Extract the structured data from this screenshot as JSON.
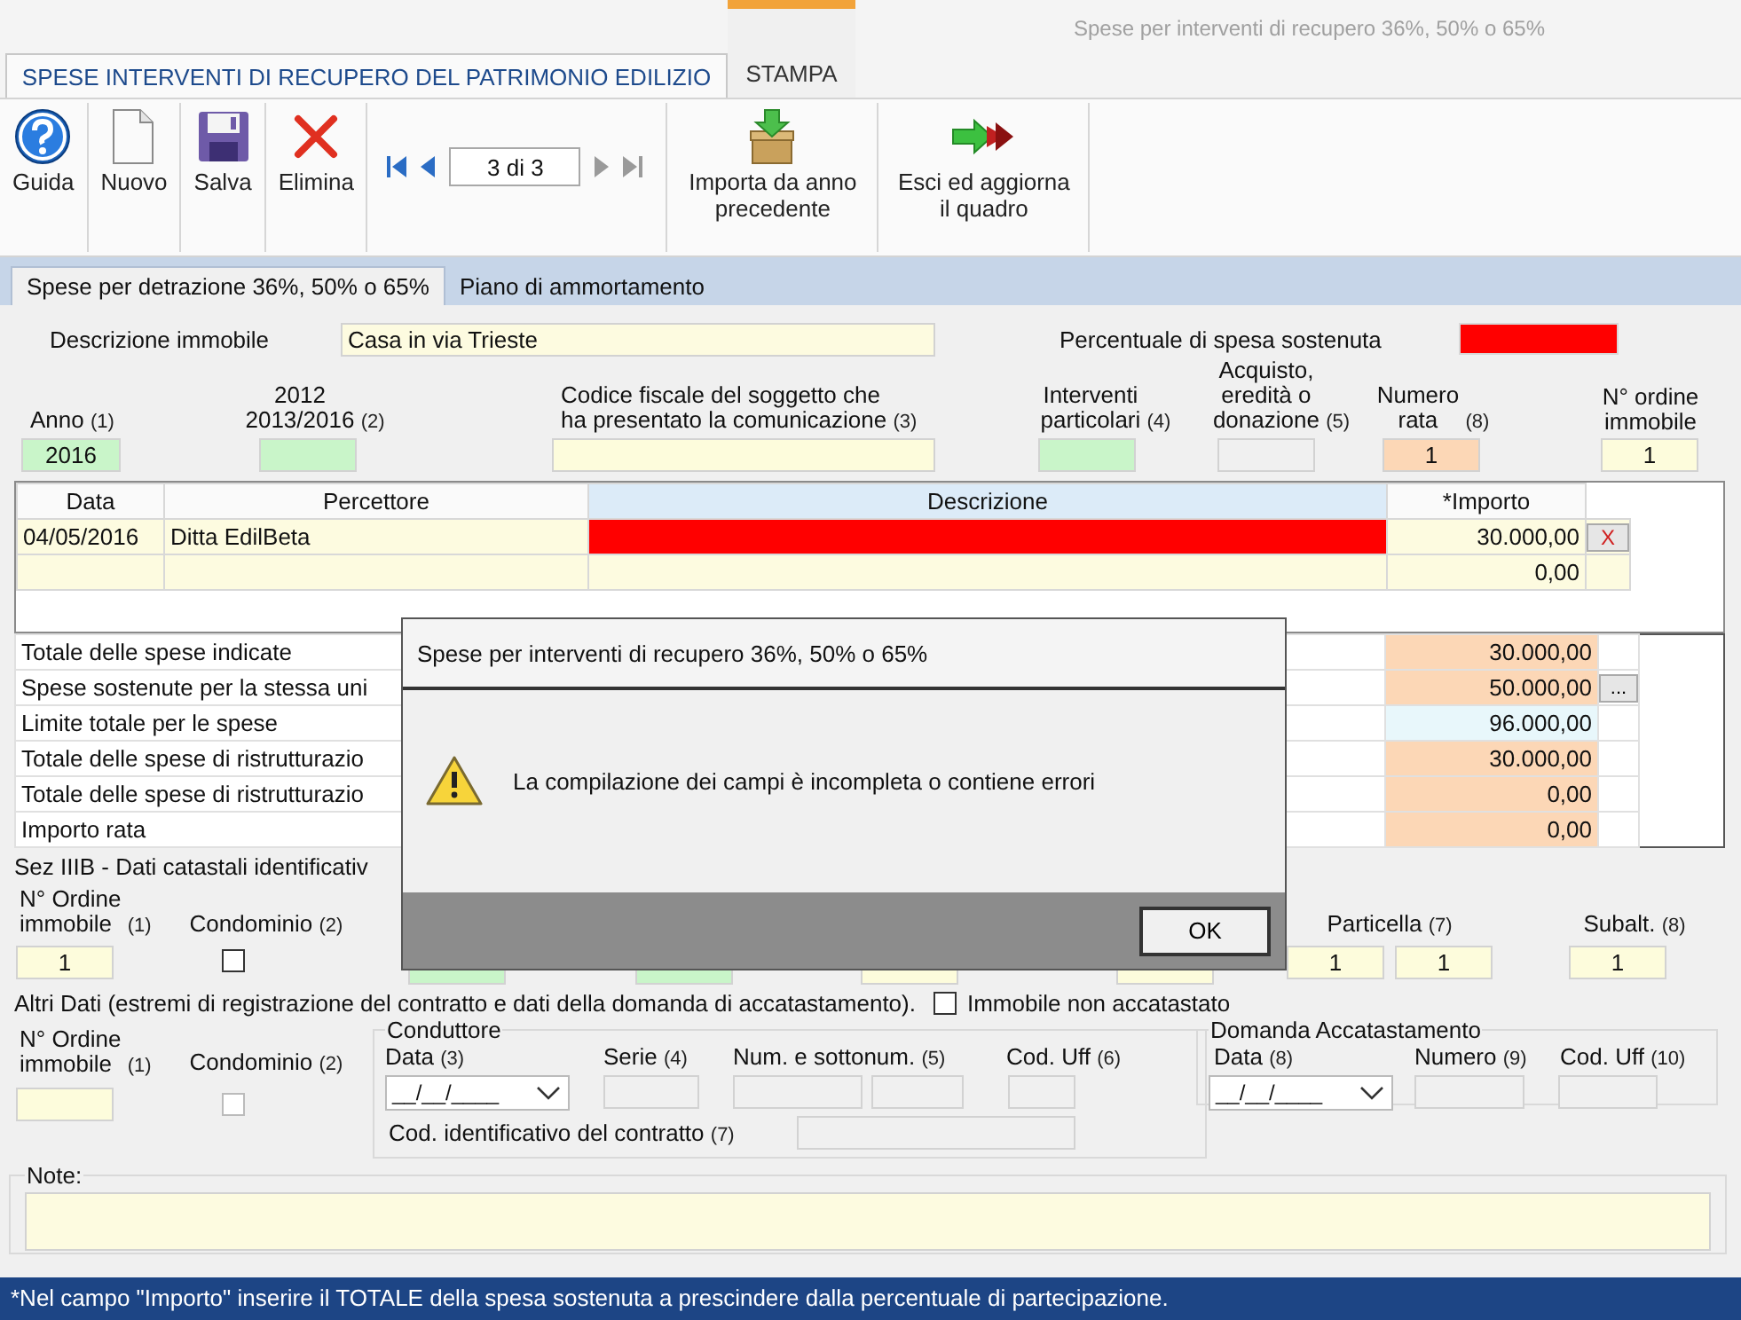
{
  "window": {
    "title": "Spese per interventi di recupero 36%, 50% o 65%"
  },
  "ribbon_tabs": [
    {
      "label": "SPESE INTERVENTI DI RECUPERO DEL PATRIMONIO EDILIZIO",
      "selected": true,
      "contextual": false
    },
    {
      "label": "STAMPA",
      "selected": false,
      "contextual": true
    }
  ],
  "toolbar": {
    "buttons": [
      {
        "label": "Guida"
      },
      {
        "label": "Nuovo"
      },
      {
        "label": "Salva"
      },
      {
        "label": "Elimina"
      }
    ],
    "record": "3 di 3",
    "actions": [
      {
        "label": "Importa da anno precedente"
      },
      {
        "label": "Esci ed aggiorna il quadro"
      }
    ]
  },
  "form_tabs": [
    {
      "label": "Spese per detrazione 36%, 50% o 65%",
      "selected": true
    },
    {
      "label": "Piano di ammortamento",
      "selected": false
    }
  ],
  "description": {
    "label": "Descrizione immobile",
    "value": "Casa in via Trieste"
  },
  "percentage": {
    "label": "Percentuale di spesa sostenuta",
    "error": true
  },
  "fields": [
    {
      "label": "Anno",
      "note": "(1)",
      "value": "2016",
      "color": "#c9f5c9"
    },
    {
      "label": "2012\n2013/2016",
      "note": "(2)",
      "color": "#c9f5c9"
    },
    {
      "label": "Codice fiscale del soggetto che\nha presentato la comunicazione",
      "note": "(3)",
      "color": "#fdfcdc"
    },
    {
      "label": "Interventi\nparticolari",
      "note": "(4)",
      "color": "#c9f5c9"
    },
    {
      "label": "Acquisto,\neredità o\ndonazione",
      "note": "(5)",
      "color": "#f0f0f0"
    },
    {
      "label": "Numero\nrata",
      "note": "(8)",
      "value": "1",
      "color": "#fcd7b6"
    },
    {
      "label": "N° ordine\nimmobile",
      "value": "1",
      "color": "#fdfcdc"
    }
  ],
  "expenses": {
    "columns": [
      {
        "label": "Data",
        "highlighted": false
      },
      {
        "label": "Percettore",
        "highlighted": false
      },
      {
        "label": "Descrizione",
        "highlighted": true
      },
      {
        "label": "*Importo",
        "highlighted": false
      }
    ],
    "rows": [
      {
        "data": "04/05/2016",
        "percettore": "Ditta EdilBeta",
        "importo": "30.000,00",
        "description_error": true,
        "delete": "X"
      },
      {
        "importo": "0,00",
        "description_error": false
      }
    ]
  },
  "totals": [
    {
      "label": "Totale delle spese indicate",
      "value": "30.000,00",
      "color": "#fcd7b6"
    },
    {
      "label": "Spese sostenute per la stessa uni",
      "value": "50.000,00",
      "color": "#fcd7b6",
      "action": "..."
    },
    {
      "label": "Limite totale per le spese",
      "value": "96.000,00",
      "color": "#e8f7fb"
    },
    {
      "label": "Totale delle spese di ristrutturazio",
      "value": "30.000,00",
      "color": "#fcd7b6"
    },
    {
      "label": "Totale delle spese di ristrutturazio",
      "value": "0,00",
      "color": "#fcd7b6"
    },
    {
      "label": "Importo rata",
      "value": "0,00",
      "color": "#fcd7b6"
    }
  ],
  "cadastral": {
    "title": "Sez IIIB - Dati catastali identificativ",
    "items": [
      {
        "kind": "field",
        "label": "N° Ordine\nimmobile",
        "note": "(1)",
        "values": [
          "1"
        ],
        "color": "#fdfcdc"
      },
      {
        "kind": "checkbox",
        "label": "Condominio",
        "note": "(2)",
        "checked": false
      },
      {
        "kind": "field",
        "color": "#c9f5c9"
      },
      {
        "kind": "field",
        "color": "#c9f5c9"
      },
      {
        "kind": "field",
        "color": "#fdfcdc"
      },
      {
        "kind": "field",
        "color": "#fdfcdc"
      },
      {
        "kind": "field",
        "label": "Particella",
        "note": "(7)",
        "values": [
          "1",
          "1"
        ],
        "color": "#fdfcdc"
      },
      {
        "kind": "field",
        "label": "Subalt.",
        "note": "(8)",
        "values": [
          "1"
        ],
        "color": "#fdfcdc"
      }
    ]
  },
  "other_data": {
    "title": "Altri Dati (estremi di registrazione del contratto e dati della domanda di accatastamento).",
    "not_registered": {
      "label": "Immobile non accatastato",
      "checked": false
    },
    "order": {
      "label": "N° Ordine\nimmobile",
      "note": "(1)"
    },
    "condominium": {
      "label": "Condominio",
      "note": "(2)",
      "checked": false,
      "disabled": true
    },
    "tenant": {
      "title": "Conduttore",
      "date": {
        "label": "Data",
        "note": "(3)",
        "value": "__/__/____"
      },
      "series": {
        "label": "Serie",
        "note": "(4)"
      },
      "number": {
        "label": "Num. e sottonum.",
        "note": "(5)"
      },
      "office": {
        "label": "Cod. Uff",
        "note": "(6)"
      },
      "contract": {
        "label": "Cod. identificativo del contratto",
        "note": "(7)"
      }
    },
    "registration": {
      "title": "Domanda Accatastamento",
      "date": {
        "label": "Data",
        "note": "(8)",
        "value": "__/__/____"
      },
      "number": {
        "label": "Numero",
        "note": "(9)"
      },
      "office": {
        "label": "Cod. Uff",
        "note": "(10)"
      }
    }
  },
  "notes": {
    "label": "Note:"
  },
  "footer": "*Nel campo \"Importo\" inserire il TOTALE della spesa sostenuta a prescindere dalla percentuale di partecipazione.",
  "dialog": {
    "title": "Spese per interventi di recupero 36%, 50% o 65%",
    "message": "La compilazione dei campi è incompleta o contiene errori",
    "button": "OK"
  }
}
